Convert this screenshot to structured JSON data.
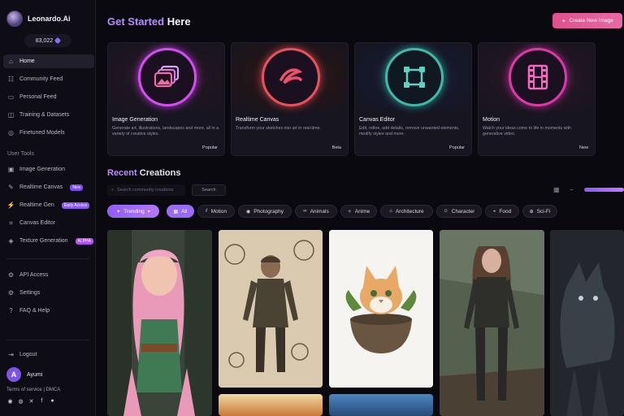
{
  "brand": {
    "name": "Leonardo.Ai",
    "tokens": "83,022"
  },
  "nav": {
    "primary": [
      {
        "label": "Home",
        "icon": "home-icon"
      },
      {
        "label": "Community Feed",
        "icon": "community-icon"
      },
      {
        "label": "Personal Feed",
        "icon": "personal-feed-icon"
      },
      {
        "label": "Training & Datasets",
        "icon": "training-icon"
      },
      {
        "label": "Finetuned Models",
        "icon": "models-icon"
      }
    ],
    "tools_label": "User Tools",
    "tools": [
      {
        "label": "Image Generation",
        "icon": "image-icon",
        "badge": ""
      },
      {
        "label": "Realtime Canvas",
        "icon": "canvas-icon",
        "badge": "New"
      },
      {
        "label": "Realtime Gen",
        "icon": "realtime-icon",
        "badge": "Early Access"
      },
      {
        "label": "Canvas Editor",
        "icon": "editor-icon",
        "badge": ""
      },
      {
        "label": "Texture Generation",
        "icon": "texture-icon",
        "badge": "ALPHA"
      }
    ],
    "secondary": [
      {
        "label": "API Access",
        "icon": "api-icon"
      },
      {
        "label": "Settings",
        "icon": "settings-icon"
      },
      {
        "label": "FAQ & Help",
        "icon": "help-icon"
      }
    ],
    "logout": "Logout"
  },
  "user": {
    "initial": "A",
    "name": "Ayumi"
  },
  "footer": {
    "terms": "Terms of service",
    "sep": "|",
    "dmca": "DMCA"
  },
  "header": {
    "title_accent": "Get Started",
    "title_rest": " Here",
    "create_label": "Create New Image"
  },
  "cards": [
    {
      "title": "Image Generation",
      "desc": "Generate art, illustrations, landscapes and more, all in a variety of creative styles.",
      "tag": "Popular",
      "color": "#d54cf0",
      "icon": "image-stack-icon"
    },
    {
      "title": "Realtime Canvas",
      "desc": "Transform your sketches into art in real-time.",
      "tag": "Beta",
      "color": "#e8505a",
      "icon": "brush-stroke-icon"
    },
    {
      "title": "Canvas Editor",
      "desc": "Edit, refine, add details, remove unwanted elements, modify styles and more.",
      "tag": "Popular",
      "color": "#3fb8a8",
      "icon": "canvas-square-icon"
    },
    {
      "title": "Motion",
      "desc": "Watch your ideas come to life in moments with generative video.",
      "tag": "New",
      "color": "#d93aa8",
      "icon": "film-icon"
    }
  ],
  "recent": {
    "title_accent": "Recent",
    "title_rest": " Creations",
    "search_placeholder": "Search community creations",
    "search_button": "Search"
  },
  "filters": [
    {
      "label": "Trending",
      "icon": "trending-icon"
    },
    {
      "label": "All",
      "icon": "all-icon"
    },
    {
      "label": "Motion",
      "icon": "motion-icon"
    },
    {
      "label": "Photography",
      "icon": "camera-icon"
    },
    {
      "label": "Animals",
      "icon": "paw-icon"
    },
    {
      "label": "Anime",
      "icon": "sparkle-icon"
    },
    {
      "label": "Architecture",
      "icon": "building-icon"
    },
    {
      "label": "Character",
      "icon": "character-icon"
    },
    {
      "label": "Food",
      "icon": "food-icon"
    },
    {
      "label": "Sci-Fi",
      "icon": "scifi-icon"
    }
  ]
}
